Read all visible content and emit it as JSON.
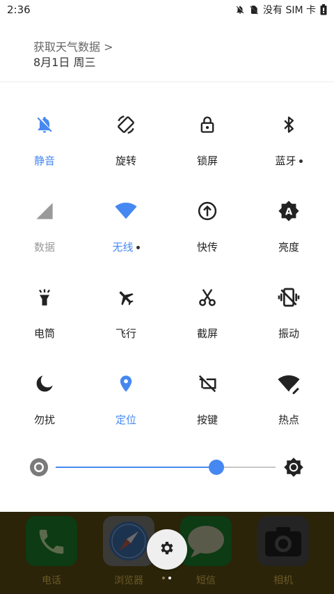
{
  "status": {
    "time": "2:36",
    "carrier": "没有 SIM 卡",
    "icons": [
      "notifications-off-icon",
      "no-sim-icon",
      "battery-icon"
    ]
  },
  "header": {
    "weather_link": "获取天气数据 >",
    "date": "8月1日 周三"
  },
  "tiles": [
    {
      "label": "静音",
      "icon": "bell-off-icon",
      "state": "on"
    },
    {
      "label": "旋转",
      "icon": "rotate-icon",
      "state": "off"
    },
    {
      "label": "锁屏",
      "icon": "lock-icon",
      "state": "off"
    },
    {
      "label": "蓝牙",
      "icon": "bluetooth-icon",
      "state": "off",
      "has_more": true
    },
    {
      "label": "数据",
      "icon": "cellular-signal-icon",
      "state": "disabled"
    },
    {
      "label": "无线",
      "icon": "wifi-icon",
      "state": "on",
      "has_more": true
    },
    {
      "label": "快传",
      "icon": "upload-icon",
      "state": "off"
    },
    {
      "label": "亮度",
      "icon": "auto-brightness-icon",
      "state": "off"
    },
    {
      "label": "电筒",
      "icon": "flashlight-icon",
      "state": "off"
    },
    {
      "label": "飞行",
      "icon": "airplane-icon",
      "state": "off"
    },
    {
      "label": "截屏",
      "icon": "scissors-icon",
      "state": "off"
    },
    {
      "label": "振动",
      "icon": "vibrate-icon",
      "state": "off"
    },
    {
      "label": "勿扰",
      "icon": "moon-icon",
      "state": "off"
    },
    {
      "label": "定位",
      "icon": "location-pin-icon",
      "state": "on"
    },
    {
      "label": "按键",
      "icon": "keys-off-icon",
      "state": "off"
    },
    {
      "label": "热点",
      "icon": "hotspot-icon",
      "state": "off"
    }
  ],
  "brightness": {
    "level": 0.73
  },
  "dock": {
    "apps": [
      {
        "label": "电话",
        "icon": "phone-icon"
      },
      {
        "label": "浏览器",
        "icon": "compass-icon"
      },
      {
        "label": "短信",
        "icon": "message-icon"
      },
      {
        "label": "相机",
        "icon": "camera-icon"
      }
    ],
    "page_count": 2,
    "current_page": 2
  },
  "colors": {
    "accent": "#4688f1",
    "dock_bg": "#2b2409"
  }
}
